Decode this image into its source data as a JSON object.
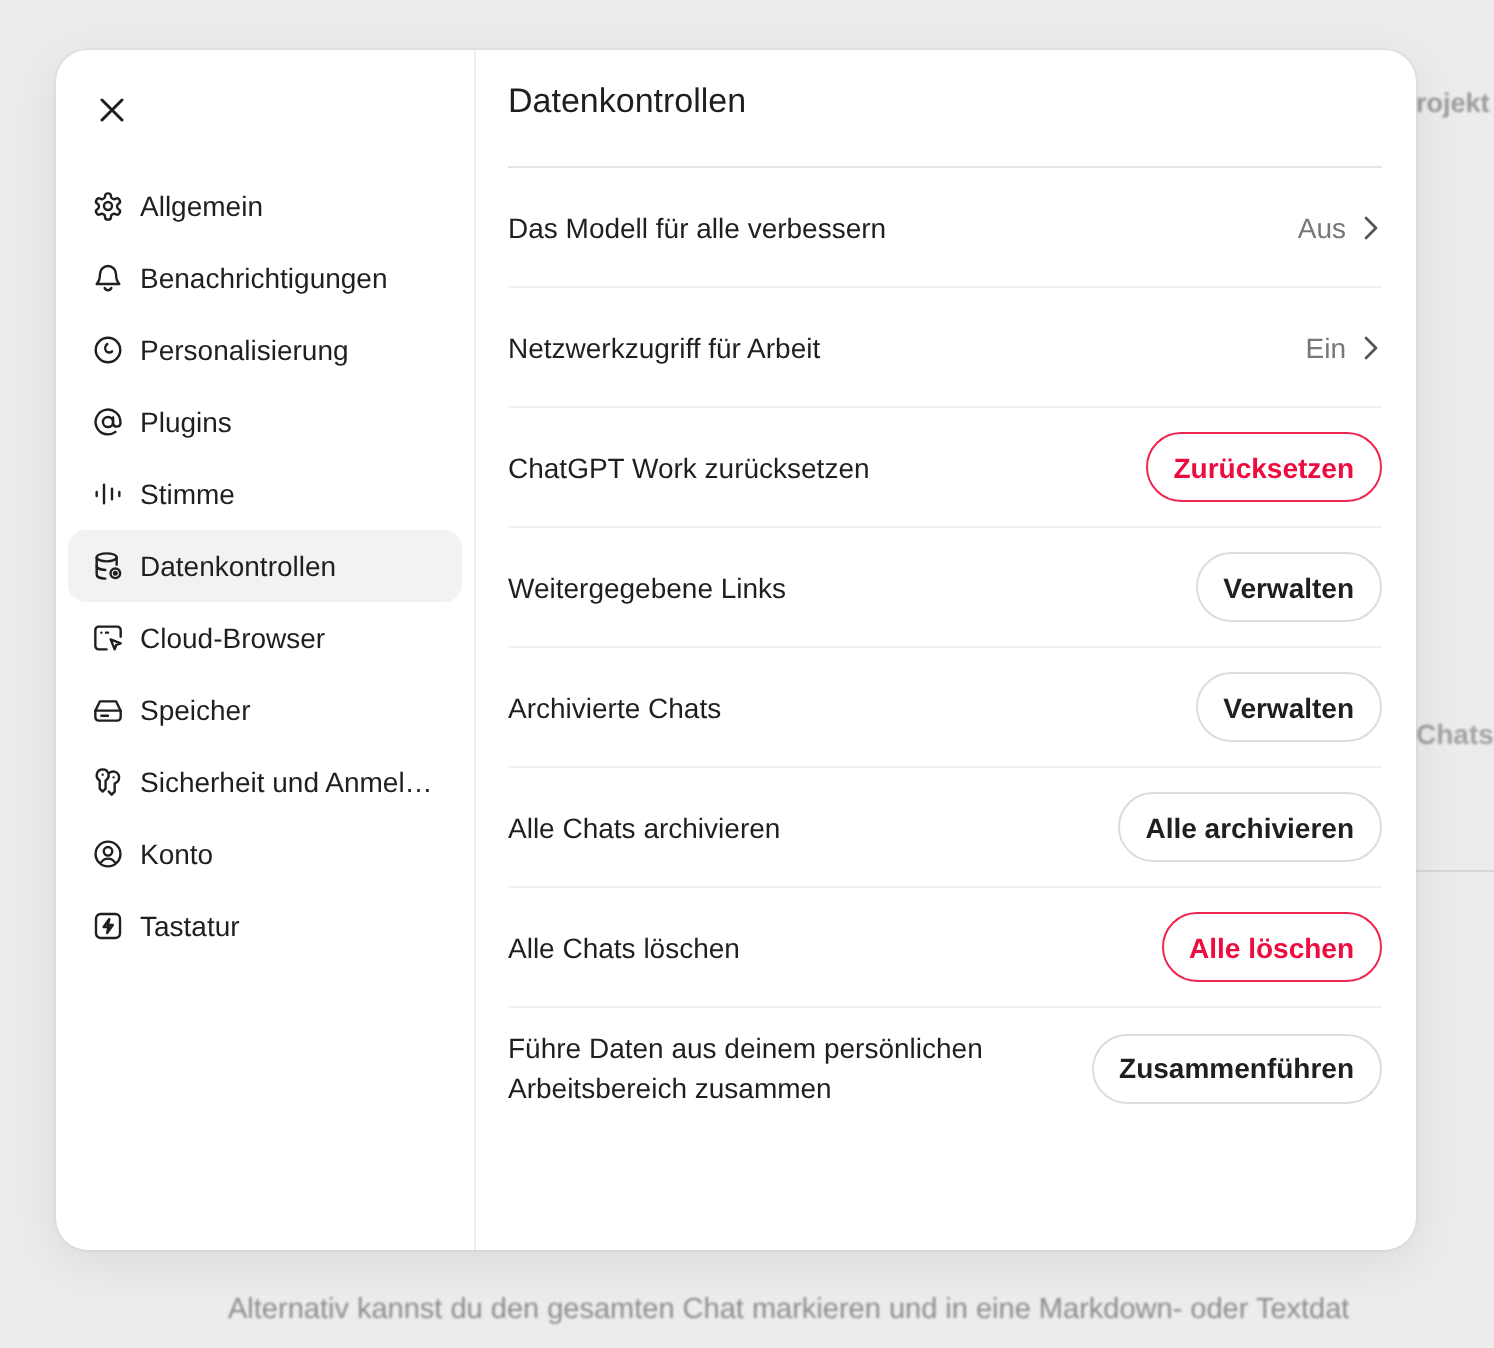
{
  "background": {
    "heading": "rojekt",
    "side_text": "Chats",
    "paragraph": "Alternativ kannst du den gesamten Chat markieren und in eine Markdown- oder Textdat"
  },
  "sidebar": {
    "items": [
      {
        "label": "Allgemein",
        "selected": false
      },
      {
        "label": "Benachrichtigungen",
        "selected": false
      },
      {
        "label": "Personalisierung",
        "selected": false
      },
      {
        "label": "Plugins",
        "selected": false
      },
      {
        "label": "Stimme",
        "selected": false
      },
      {
        "label": "Datenkontrollen",
        "selected": true
      },
      {
        "label": "Cloud-Browser",
        "selected": false
      },
      {
        "label": "Speicher",
        "selected": false
      },
      {
        "label": "Sicherheit und Anmel…",
        "selected": false
      },
      {
        "label": "Konto",
        "selected": false
      },
      {
        "label": "Tastatur",
        "selected": false
      }
    ]
  },
  "panel": {
    "title": "Datenkontrollen",
    "rows": [
      {
        "kind": "link",
        "label": "Das Modell für alle verbessern",
        "value": "Aus"
      },
      {
        "kind": "link",
        "label": "Netzwerkzugriff für Arbeit",
        "value": "Ein"
      },
      {
        "kind": "button",
        "label": "ChatGPT Work zurücksetzen",
        "button": "Zurücksetzen",
        "danger": true
      },
      {
        "kind": "button",
        "label": "Weitergegebene Links",
        "button": "Verwalten",
        "danger": false
      },
      {
        "kind": "button",
        "label": "Archivierte Chats",
        "button": "Verwalten",
        "danger": false
      },
      {
        "kind": "button",
        "label": "Alle Chats archivieren",
        "button": "Alle archivieren",
        "danger": false
      },
      {
        "kind": "button",
        "label": "Alle Chats löschen",
        "button": "Alle löschen",
        "danger": true
      },
      {
        "kind": "button",
        "label": "Führe Daten aus deinem persönlichen Arbeitsbereich zusammen",
        "button": "Zusammenführen",
        "danger": false
      }
    ]
  }
}
